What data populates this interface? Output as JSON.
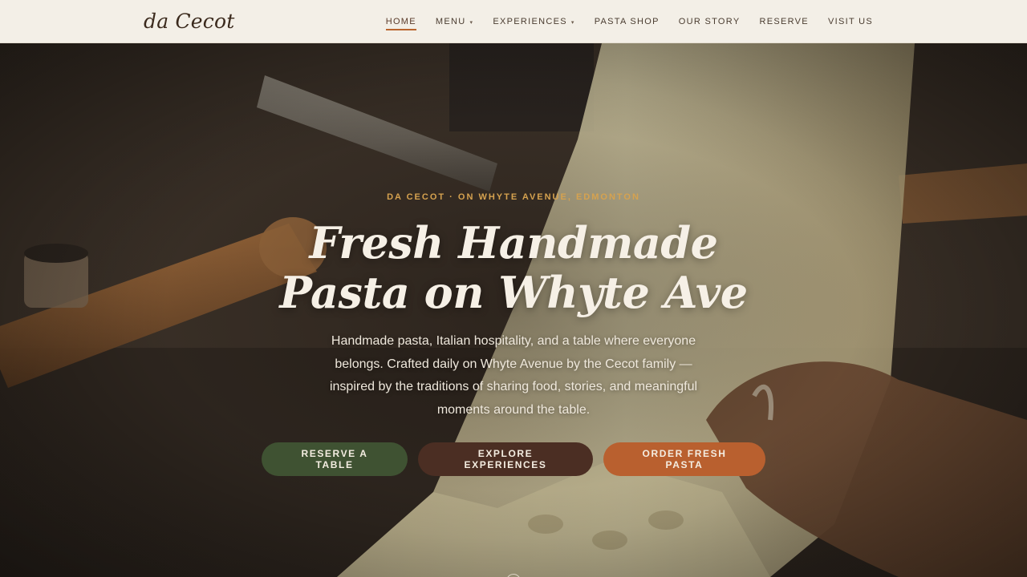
{
  "brand": {
    "logo": "da Cecot"
  },
  "nav": {
    "items": [
      {
        "label": "HOME",
        "active": true,
        "has_dropdown": false
      },
      {
        "label": "MENU",
        "active": false,
        "has_dropdown": true
      },
      {
        "label": "EXPERIENCES",
        "active": false,
        "has_dropdown": true
      },
      {
        "label": "PASTA SHOP",
        "active": false,
        "has_dropdown": false
      },
      {
        "label": "OUR STORY",
        "active": false,
        "has_dropdown": false
      },
      {
        "label": "RESERVE",
        "active": false,
        "has_dropdown": false
      },
      {
        "label": "VISIT US",
        "active": false,
        "has_dropdown": false
      }
    ],
    "dropdown_glyph": "▾"
  },
  "hero": {
    "eyebrow": "DA CECOT · ON WHYTE AVENUE, EDMONTON",
    "title_line1": "Fresh Handmade",
    "title_line2": "Pasta on Whyte Ave",
    "description": "Handmade pasta, Italian hospitality, and a table where everyone belongs. Crafted daily on Whyte Avenue by the Cecot family — inspired by the traditions of sharing food, stories, and meaningful moments around the table.",
    "buttons": {
      "reserve": "RESERVE A TABLE",
      "explore": "EXPLORE EXPERIENCES",
      "order": "ORDER FRESH PASTA"
    },
    "background_image": "pasta-making-photo"
  },
  "colors": {
    "header_bg": "#f3efe7",
    "accent_orange": "#b9602f",
    "accent_green": "#3f5232",
    "accent_brown": "#4b2e23",
    "eyebrow_gold": "#d6a24f"
  }
}
